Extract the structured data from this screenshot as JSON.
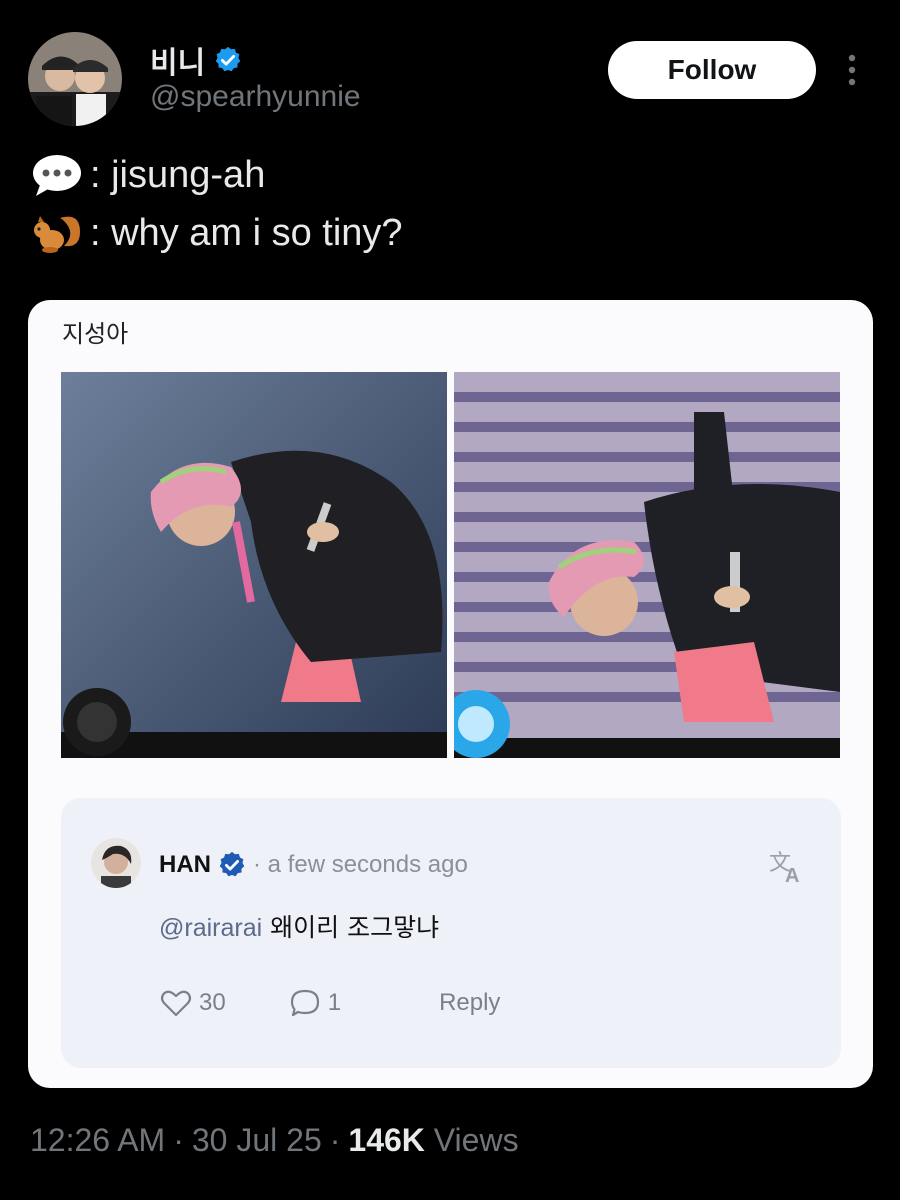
{
  "author": {
    "display_name": "비니",
    "handle": "@spearhyunnie",
    "verified": true
  },
  "follow_label": "Follow",
  "tweet": {
    "line1_text": ": jisung-ah",
    "line1_icon": "speech-bubble-icon",
    "line2_text": ": why am i so tiny?",
    "line2_icon": "squirrel-icon"
  },
  "card": {
    "caption": "지성아",
    "comment": {
      "author": "HAN",
      "time": "· a few seconds ago",
      "mention": "@rairarai",
      "text": " 왜이리 조그맣냐",
      "likes": "30",
      "replies": "1",
      "reply_label": "Reply"
    }
  },
  "meta": {
    "time": "12:26 AM",
    "date": "30 Jul 25",
    "views_count": "146K",
    "views_label": " Views"
  },
  "colors": {
    "background": "#000000",
    "verified_blue": "#1d9bf0",
    "muted": "#71767b",
    "card_bg": "#fbfbfd",
    "comment_bg": "#eef1f8"
  }
}
